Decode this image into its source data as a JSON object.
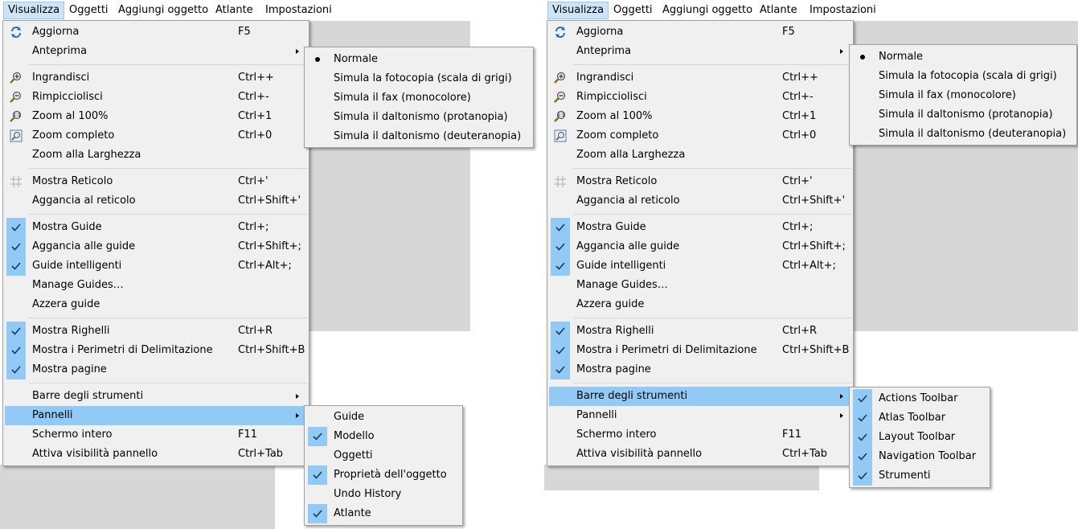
{
  "menubar": [
    "Visualizza",
    "Oggetti",
    "Aggiungi oggetto",
    "Atlante",
    "Impostazioni"
  ],
  "view_menu": {
    "aggiorna": {
      "label": "Aggiorna",
      "shortcut": "F5"
    },
    "anteprima": {
      "label": "Anteprima"
    },
    "ingrandisci": {
      "label": "Ingrandisci",
      "shortcut": "Ctrl++"
    },
    "rimpicciolisci": {
      "label": "Rimpicciolisci",
      "shortcut": "Ctrl+-"
    },
    "zoom100": {
      "label": "Zoom al 100%",
      "shortcut": "Ctrl+1"
    },
    "zoom_completo": {
      "label": "Zoom completo",
      "shortcut": "Ctrl+0"
    },
    "zoom_larghezza": {
      "label": "Zoom alla Larghezza"
    },
    "mostra_reticolo": {
      "label": "Mostra Reticolo",
      "shortcut": "Ctrl+'"
    },
    "aggancia_reticolo": {
      "label": "Aggancia al reticolo",
      "shortcut": "Ctrl+Shift+'"
    },
    "mostra_guide": {
      "label": "Mostra Guide",
      "shortcut": "Ctrl+;"
    },
    "aggancia_guide": {
      "label": "Aggancia alle guide",
      "shortcut": "Ctrl+Shift+;"
    },
    "guide_intelligenti": {
      "label": "Guide intelligenti",
      "shortcut": "Ctrl+Alt+;"
    },
    "manage_guides": {
      "label": "Manage Guides…"
    },
    "azzera_guide": {
      "label": "Azzera guide"
    },
    "mostra_righelli": {
      "label": "Mostra Righelli",
      "shortcut": "Ctrl+R"
    },
    "mostra_perimetri": {
      "label": "Mostra i Perimetri di Delimitazione",
      "shortcut": "Ctrl+Shift+B"
    },
    "mostra_pagine": {
      "label": "Mostra pagine"
    },
    "barre_strumenti": {
      "label": "Barre degli strumenti"
    },
    "pannelli": {
      "label": "Pannelli"
    },
    "schermo_intero": {
      "label": "Schermo intero",
      "shortcut": "F11"
    },
    "attiva_visibilita": {
      "label": "Attiva visibilità pannello",
      "shortcut": "Ctrl+Tab"
    }
  },
  "preview_submenu": [
    "Normale",
    "Simula la fotocopia (scala di grigi)",
    "Simula il fax (monocolore)",
    "Simula il daltonismo (protanopia)",
    "Simula il daltonismo (deuteranopia)"
  ],
  "panels_submenu": [
    "Guide",
    "Modello",
    "Oggetti",
    "Proprietà dell'oggetto",
    "Undo History",
    "Atlante"
  ],
  "toolbars_submenu": [
    "Actions Toolbar",
    "Atlas Toolbar",
    "Layout Toolbar",
    "Navigation Toolbar",
    "Strumenti"
  ],
  "colors": {
    "highlight": "#91c9f7",
    "menu_bg": "#f0f0f0",
    "menubar_active": "#cce4f7",
    "canvas_gray": "#d7d7d7"
  }
}
